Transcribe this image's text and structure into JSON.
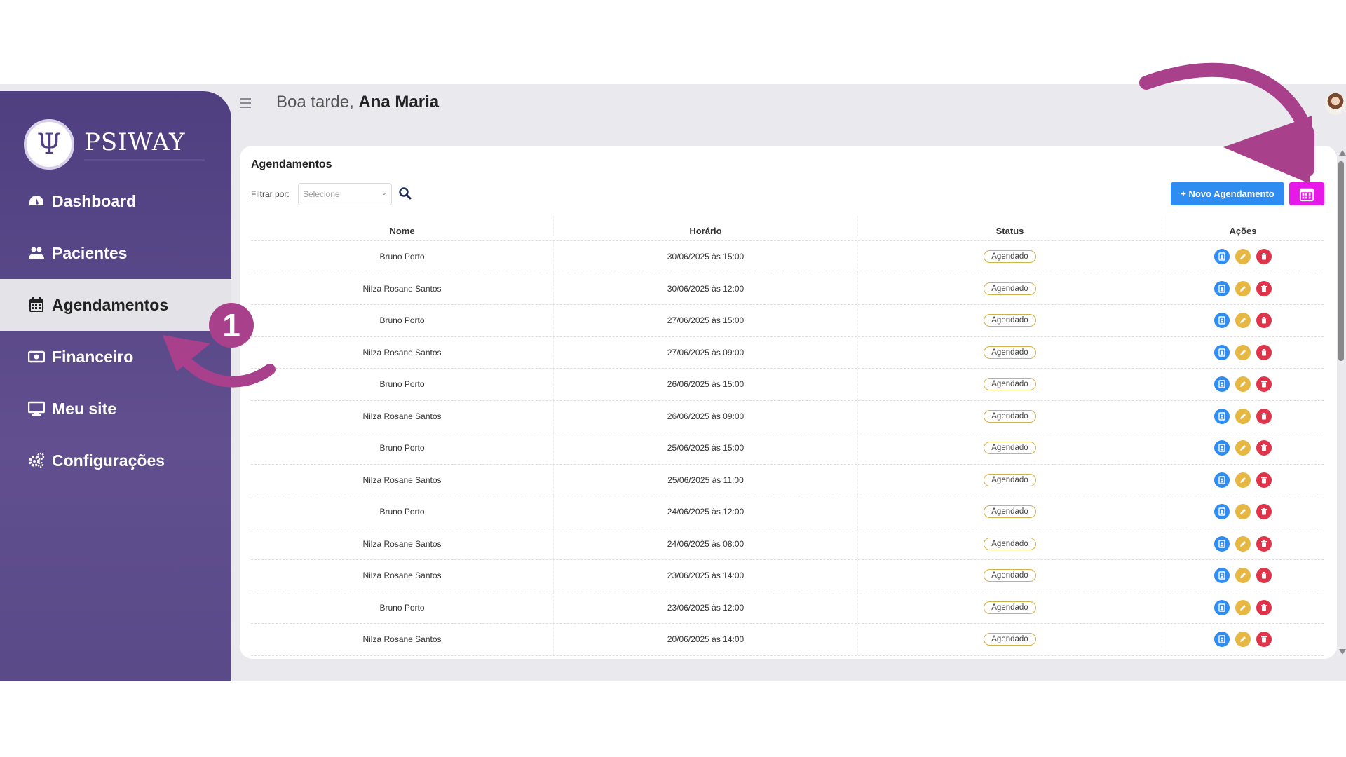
{
  "brand": {
    "name": "PSIWAY",
    "logo_glyph": "Ψ"
  },
  "header": {
    "greeting_prefix": "Boa tarde,",
    "user_name": "Ana Maria"
  },
  "sidebar": {
    "items": [
      {
        "label": "Dashboard",
        "icon": "dashboard-icon"
      },
      {
        "label": "Pacientes",
        "icon": "users-icon"
      },
      {
        "label": "Agendamentos",
        "icon": "calendar-icon",
        "active": true
      },
      {
        "label": "Financeiro",
        "icon": "money-icon"
      },
      {
        "label": "Meu site",
        "icon": "monitor-icon"
      },
      {
        "label": "Configurações",
        "icon": "gears-icon"
      }
    ]
  },
  "main": {
    "title": "Agendamentos",
    "filter_label": "Filtrar por:",
    "filter_placeholder": "Selecione",
    "new_button_label": "+ Novo Agendamento",
    "columns": [
      "Nome",
      "Horário",
      "Status",
      "Ações"
    ],
    "rows": [
      {
        "nome": "Bruno Porto",
        "horario": "30/06/2025 às 15:00",
        "status": "Agendado"
      },
      {
        "nome": "Nilza Rosane Santos",
        "horario": "30/06/2025 às 12:00",
        "status": "Agendado"
      },
      {
        "nome": "Bruno Porto",
        "horario": "27/06/2025 às 15:00",
        "status": "Agendado"
      },
      {
        "nome": "Nilza Rosane Santos",
        "horario": "27/06/2025 às 09:00",
        "status": "Agendado"
      },
      {
        "nome": "Bruno Porto",
        "horario": "26/06/2025 às 15:00",
        "status": "Agendado"
      },
      {
        "nome": "Nilza Rosane Santos",
        "horario": "26/06/2025 às 09:00",
        "status": "Agendado"
      },
      {
        "nome": "Bruno Porto",
        "horario": "25/06/2025 às 15:00",
        "status": "Agendado"
      },
      {
        "nome": "Nilza Rosane Santos",
        "horario": "25/06/2025 às 11:00",
        "status": "Agendado"
      },
      {
        "nome": "Bruno Porto",
        "horario": "24/06/2025 às 12:00",
        "status": "Agendado"
      },
      {
        "nome": "Nilza Rosane Santos",
        "horario": "24/06/2025 às 08:00",
        "status": "Agendado"
      },
      {
        "nome": "Nilza Rosane Santos",
        "horario": "23/06/2025 às 14:00",
        "status": "Agendado"
      },
      {
        "nome": "Bruno Porto",
        "horario": "23/06/2025 às 12:00",
        "status": "Agendado"
      },
      {
        "nome": "Nilza Rosane Santos",
        "horario": "20/06/2025 às 14:00",
        "status": "Agendado"
      }
    ]
  },
  "annotation": {
    "step_number": "1"
  },
  "colors": {
    "sidebar": "#57478a",
    "accent_blue": "#2f8cf0",
    "calendar_button": "#e619e6",
    "arrow": "#a8408c"
  }
}
